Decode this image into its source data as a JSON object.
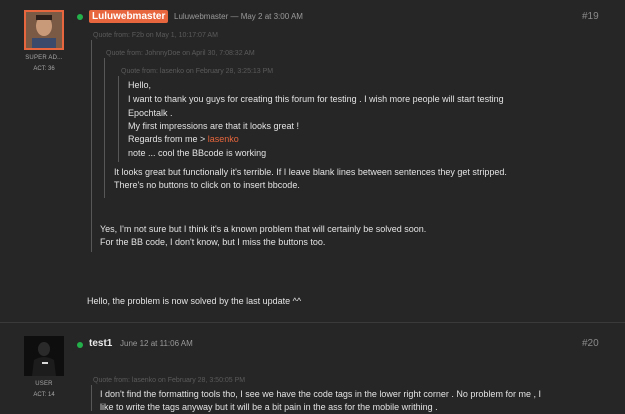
{
  "post1": {
    "username_badge": "Luluwebmaster",
    "meta": "Luluwebmaster — May 2 at 3:00 AM",
    "post_number": "#19",
    "role": "SUPER AD...",
    "act": "ACT: 36",
    "quote_outer_header": "Quote from: F2b on May 1, 10:17:07 AM",
    "quote_mid_header": "Quote from: JohnnyDoe on April 30, 7:08:32 AM",
    "quote_inner_header": "Quote from: lasenko on February 28, 3:25:13 PM",
    "inner_lines": [
      "Hello,",
      "I want to thank you guys for creating this forum for testing .  I wish more people will start testing",
      "Epochtalk .",
      "My first impressions are that it looks great !"
    ],
    "regards_prefix": "Regards from me > ",
    "regards_name": "lasenko",
    "note_line": "note ... cool the BBcode is working",
    "mid_lines": [
      "It looks great but functionally it's terrible. If I leave blank lines between sentences they get stripped.",
      "There's no buttons to click on to insert bbcode."
    ],
    "outer_lines": [
      "Yes, I'm not sure but I think it's a known problem that will certainly be solved soon.",
      "For the BB code, I don't know, but I miss the buttons too."
    ],
    "reply": "Hello, the problem is now solved by the last update ^^"
  },
  "post2": {
    "username": "test1",
    "meta": "June 12 at 11:06 AM",
    "post_number": "#20",
    "role": "USER",
    "act": "ACT: 14",
    "quote_header": "Quote from: lasenko on February 28, 3:50:05 PM",
    "quote_lines": [
      "I don't find the formatting tools tho, I see we have the code tags in the lower right corner . No problem for me , I",
      "like to write the tags anyway but it will be a bit pain in the ass for the  mobile writhing ."
    ]
  }
}
